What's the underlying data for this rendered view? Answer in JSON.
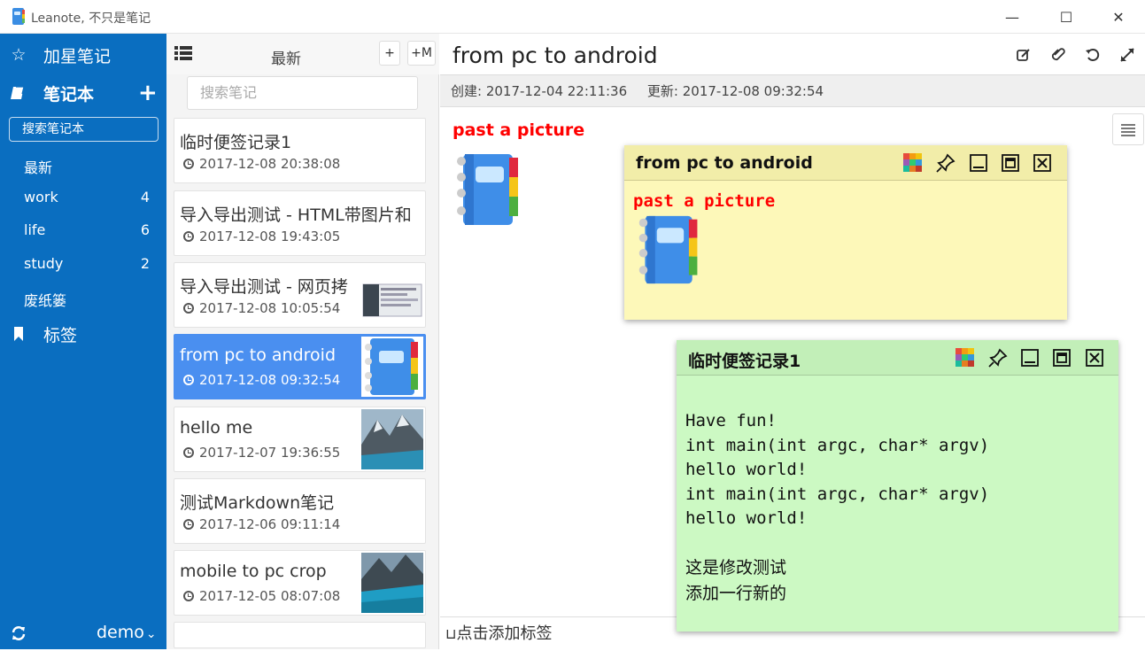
{
  "window": {
    "title": "Leanote, 不只是笔记",
    "minimize": "—",
    "maximize": "☐",
    "close": "✕"
  },
  "sidebar": {
    "starred_label": "加星笔记",
    "notebooks_label": "笔记本",
    "add_notebook": "+",
    "search_placeholder": "搜索笔记本",
    "notebooks": [
      {
        "label": "最新",
        "count": ""
      },
      {
        "label": "work",
        "count": "4"
      },
      {
        "label": "life",
        "count": "6"
      },
      {
        "label": "study",
        "count": "2"
      },
      {
        "label": "废纸篓",
        "count": ""
      }
    ],
    "tags_label": "标签",
    "user": "demo"
  },
  "notelist": {
    "title": "最新",
    "add_button": "+",
    "add_markdown_button": "+M",
    "search_placeholder": "搜索笔记",
    "notes": [
      {
        "title": "临时便签记录1",
        "date": "2017-12-08 20:38:08"
      },
      {
        "title": "导入导出测试 - HTML带图片和",
        "date": "2017-12-08 19:43:05"
      },
      {
        "title": "导入导出测试 - 网页拷",
        "date": "2017-12-08 10:05:54"
      },
      {
        "title": "from pc to android",
        "date": "2017-12-08 09:32:54"
      },
      {
        "title": "hello me",
        "date": "2017-12-07 19:36:55"
      },
      {
        "title": "测试Markdown笔记",
        "date": "2017-12-06 09:11:14"
      },
      {
        "title": "mobile to pc crop",
        "date": "2017-12-05 08:07:08"
      }
    ]
  },
  "editor": {
    "title": "from pc to android",
    "created": "创建: 2017-12-04 22:11:36",
    "updated": "更新: 2017-12-08 09:32:54",
    "heading": "past a picture",
    "add_tag": "点击添加标签"
  },
  "sticky1": {
    "title": "from pc to android",
    "heading": "past a picture",
    "color": "#fdf8b9"
  },
  "sticky2": {
    "title": "临时便签记录1",
    "color": "#ccf9c3",
    "lines": [
      "Have fun!",
      "int main(int argc, char* argv)",
      "hello world!",
      "int main(int argc, char* argv)",
      "hello world!"
    ],
    "text_lines": [
      "这是修改测试",
      "添加一行新的"
    ]
  }
}
